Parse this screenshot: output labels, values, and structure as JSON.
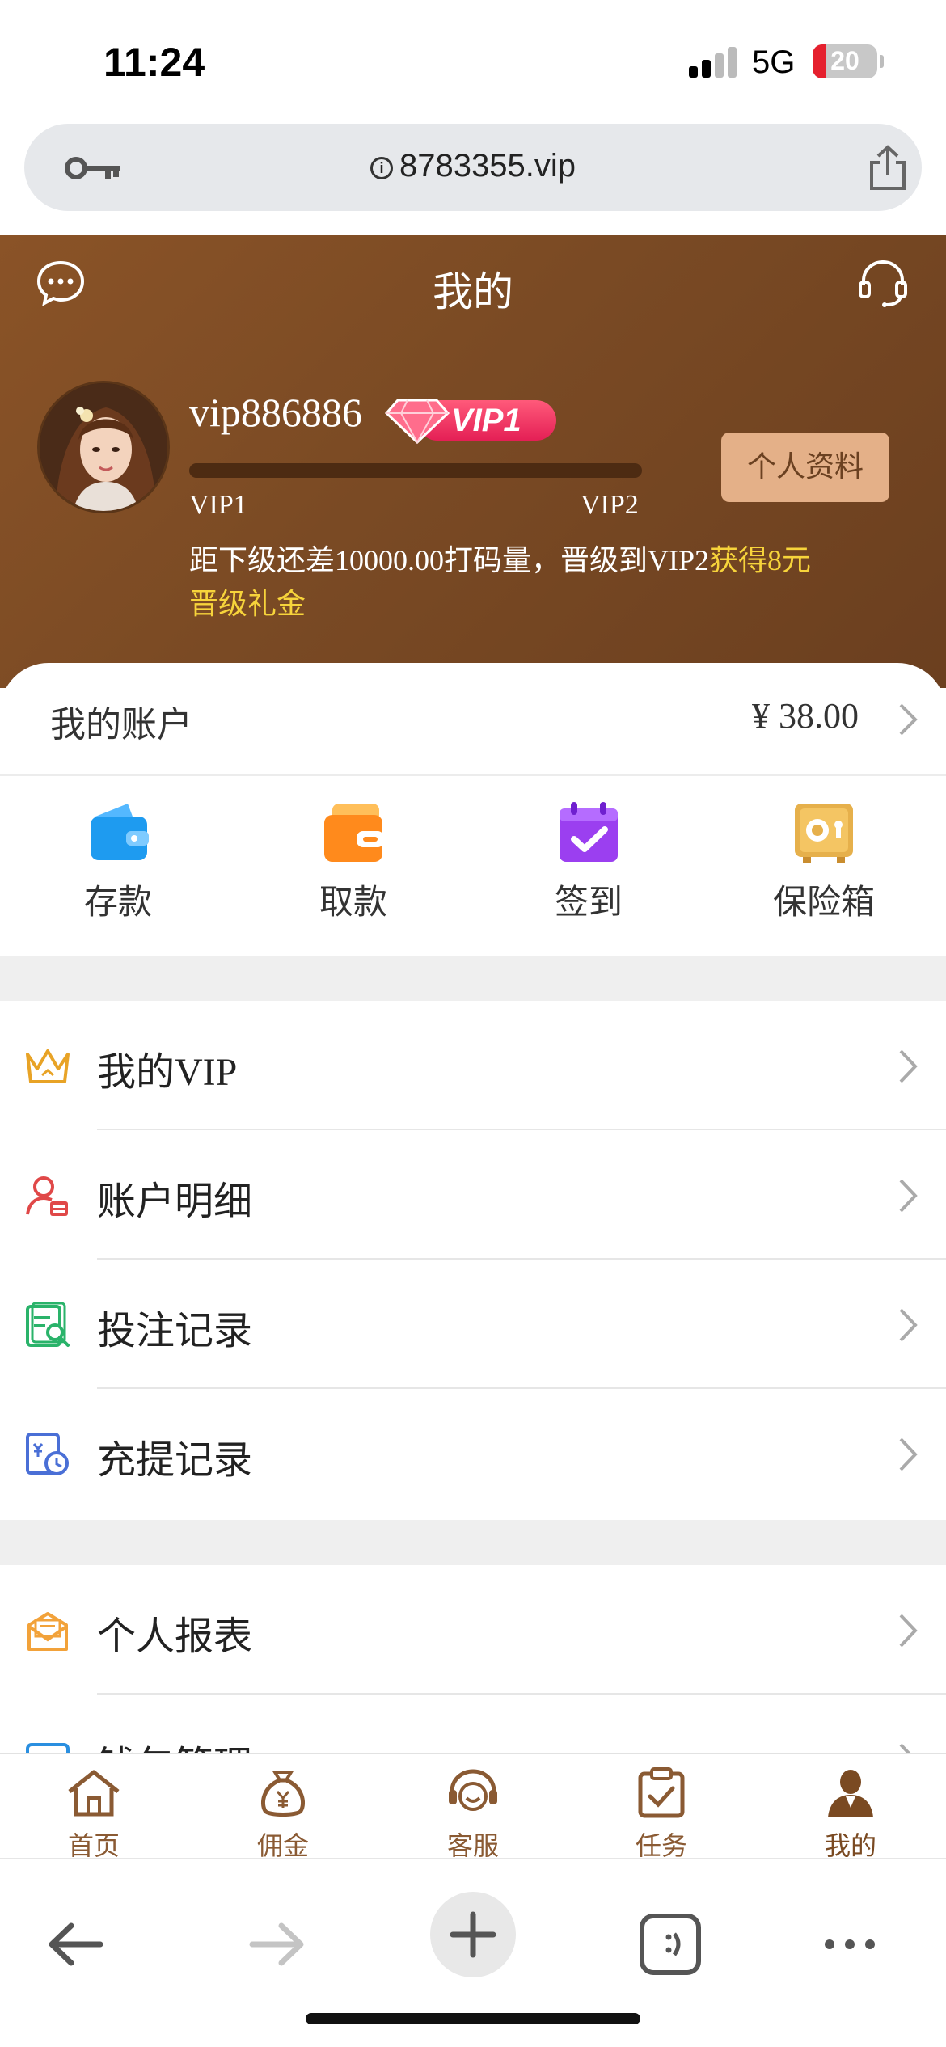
{
  "status_bar": {
    "time": "11:24",
    "network": "5G",
    "battery": "20",
    "battery_level": 0.2
  },
  "browser": {
    "url": "8783355.vip"
  },
  "header": {
    "title": "我的"
  },
  "profile": {
    "username": "vip886886",
    "vip_badge": "VIP1",
    "level_from": "VIP1",
    "level_to": "VIP2",
    "progress": 0.0,
    "upgrade_message": "距下级还差10000.00打码量，晋级到VIP2",
    "upgrade_reward": "获得8元晋级礼金",
    "profile_button": "个人资料"
  },
  "account": {
    "label": "我的账户",
    "balance": "¥ 38.00"
  },
  "actions": [
    {
      "label": "存款",
      "icon": "wallet-icon"
    },
    {
      "label": "取款",
      "icon": "withdraw-wallet-icon"
    },
    {
      "label": "签到",
      "icon": "calendar-check-icon"
    },
    {
      "label": "保险箱",
      "icon": "safe-icon"
    }
  ],
  "menu_group_1": [
    {
      "label": "我的VIP",
      "icon": "crown-icon"
    },
    {
      "label": "账户明细",
      "icon": "user-detail-icon"
    },
    {
      "label": "投注记录",
      "icon": "bet-record-icon"
    },
    {
      "label": "充提记录",
      "icon": "transaction-record-icon"
    }
  ],
  "menu_group_2": [
    {
      "label": "个人报表",
      "icon": "report-icon"
    },
    {
      "label": "钱包管理",
      "icon": "wallet-manage-icon"
    }
  ],
  "tabs": [
    {
      "label": "首页",
      "icon": "home-icon"
    },
    {
      "label": "佣金",
      "icon": "money-bag-icon"
    },
    {
      "label": "客服",
      "icon": "support-icon"
    },
    {
      "label": "任务",
      "icon": "task-icon"
    },
    {
      "label": "我的",
      "icon": "profile-icon",
      "active": true
    }
  ],
  "colors": {
    "header_brown": "#7a4a24",
    "accent_gold": "#e4b088",
    "highlight_yellow": "#f7d43b",
    "vip_pink": "#e41f55"
  }
}
